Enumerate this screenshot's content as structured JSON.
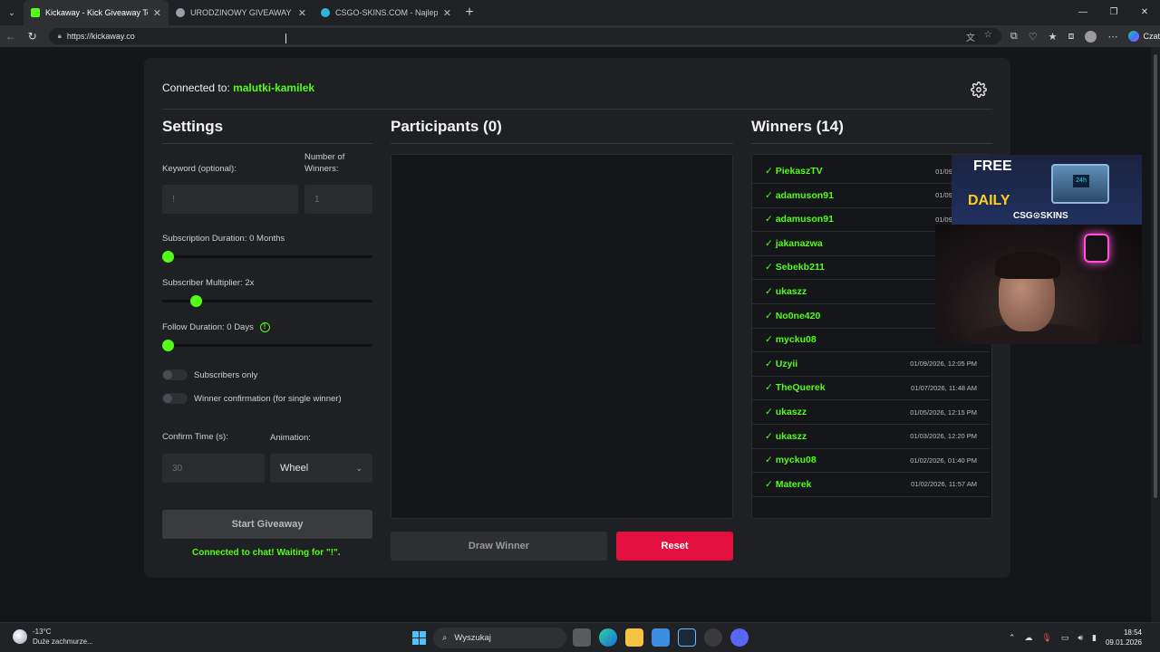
{
  "browser": {
    "tabs": [
      {
        "title": "Kickaway - Kick Giveaway Tool",
        "active": true,
        "favicon_color": "#53fc18"
      },
      {
        "title": "URODZINOWY GIVEAWAY KAMILKA",
        "active": false,
        "favicon_color": "#9aa0a6"
      },
      {
        "title": "CSGO-SKINS.COM - Najlepsze Skrz",
        "active": false,
        "favicon_color": "#2bb5d8"
      }
    ],
    "url": "https://kickaway.co",
    "copilot_label": "Czat"
  },
  "app": {
    "connected_prefix": "Connected to:",
    "channel": "malutki-kamilek",
    "settings": {
      "title": "Settings",
      "keyword_label": "Keyword (optional):",
      "keyword_placeholder": "!",
      "winners_label": "Number of Winners:",
      "winners_placeholder": "1",
      "sub_duration_label": "Subscription Duration: 0 Months",
      "sub_duration_value": 0,
      "sub_multiplier_label": "Subscriber Multiplier: 2x",
      "sub_multiplier_value": 0.14,
      "follow_duration_label": "Follow Duration: 0 Days",
      "follow_duration_value": 0,
      "subscribers_only_label": "Subscribers only",
      "winner_confirmation_label": "Winner confirmation (for single winner)",
      "confirm_time_label": "Confirm Time (s):",
      "confirm_time_placeholder": "30",
      "animation_label": "Animation:",
      "animation_value": "Wheel",
      "start_button": "Start Giveaway",
      "status": "Connected to chat! Waiting for \"!\"."
    },
    "participants": {
      "title": "Participants (0)",
      "draw_button": "Draw Winner",
      "reset_button": "Reset"
    },
    "winners": {
      "title": "Winners (14)",
      "list": [
        {
          "name": "✓ PiekaszTV",
          "date": "01/09/2026, 0"
        },
        {
          "name": "✓ adamuson91",
          "date": "01/09/2026, 0"
        },
        {
          "name": "✓ adamuson91",
          "date": "01/09/2026, 0"
        },
        {
          "name": "✓ jakanazwa",
          "date": "01/09/2"
        },
        {
          "name": "✓ Sebekb211",
          "date": "01/09/20"
        },
        {
          "name": "✓ ukaszz",
          "date": "01/09/20"
        },
        {
          "name": "✓ No0ne420",
          "date": "01/09/20"
        },
        {
          "name": "✓ mycku08",
          "date": "01/09/2"
        },
        {
          "name": "✓ Uzyii",
          "date": "01/09/2026, 12:05 PM"
        },
        {
          "name": "✓ TheQuerek",
          "date": "01/07/2026, 11:48 AM"
        },
        {
          "name": "✓ ukaszz",
          "date": "01/05/2026, 12:15 PM"
        },
        {
          "name": "✓ ukaszz",
          "date": "01/03/2026, 12:20 PM"
        },
        {
          "name": "✓ mycku08",
          "date": "01/02/2026, 01:40 PM"
        },
        {
          "name": "✓ Materek",
          "date": "01/02/2026, 11:57 AM"
        }
      ]
    }
  },
  "overlay": {
    "ad_free": "FREE",
    "ad_daily": "DAILY",
    "ad_brand": "CSG⊙SKINS",
    "ad_chest_badge": "24h"
  },
  "taskbar": {
    "temperature": "-13°C",
    "weather_desc": "Duże zachmurze...",
    "search_label": "Wyszukaj",
    "time": "18:54",
    "date": "09.01.2026"
  }
}
